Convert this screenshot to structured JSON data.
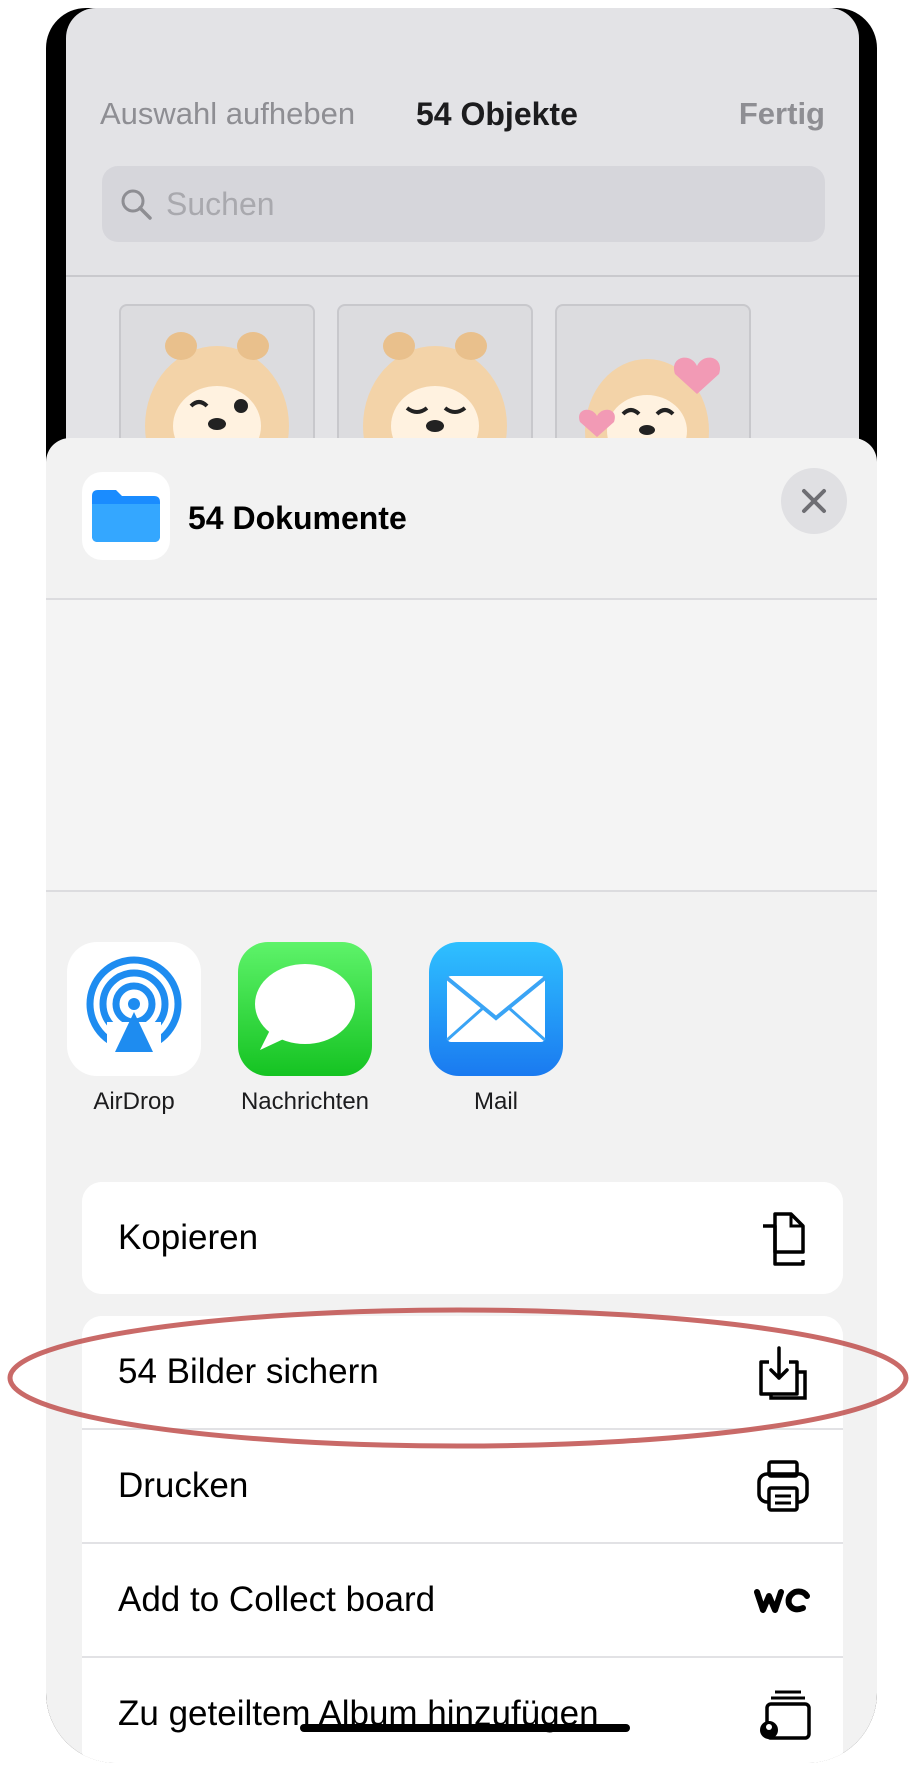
{
  "header": {
    "deselect_label": "Auswahl aufheben",
    "count_label": "54 Objekte",
    "done_label": "Fertig"
  },
  "search": {
    "placeholder": "Suchen"
  },
  "sheet": {
    "title": "54 Dokumente",
    "icons": {
      "file": "folder-icon",
      "close": "close-icon"
    }
  },
  "apps": [
    {
      "label": "AirDrop",
      "icon": "airdrop-icon"
    },
    {
      "label": "Nachrichten",
      "icon": "messages-icon"
    },
    {
      "label": "Mail",
      "icon": "mail-icon"
    }
  ],
  "actions": [
    {
      "label": "Kopieren",
      "icon": "copy-icon"
    },
    {
      "label": "54 Bilder sichern",
      "icon": "save-image-icon"
    },
    {
      "label": "Drucken",
      "icon": "print-icon"
    },
    {
      "label": "Add to Collect board",
      "icon": "we-collect-icon"
    },
    {
      "label": "Zu geteiltem Album hinzufügen",
      "icon": "shared-album-icon"
    }
  ],
  "colors": {
    "annotation": "#c0504d",
    "messages_green": "#2ecc40",
    "mail_blue": "#1a8cff",
    "airdrop_blue": "#1e8cf0"
  }
}
